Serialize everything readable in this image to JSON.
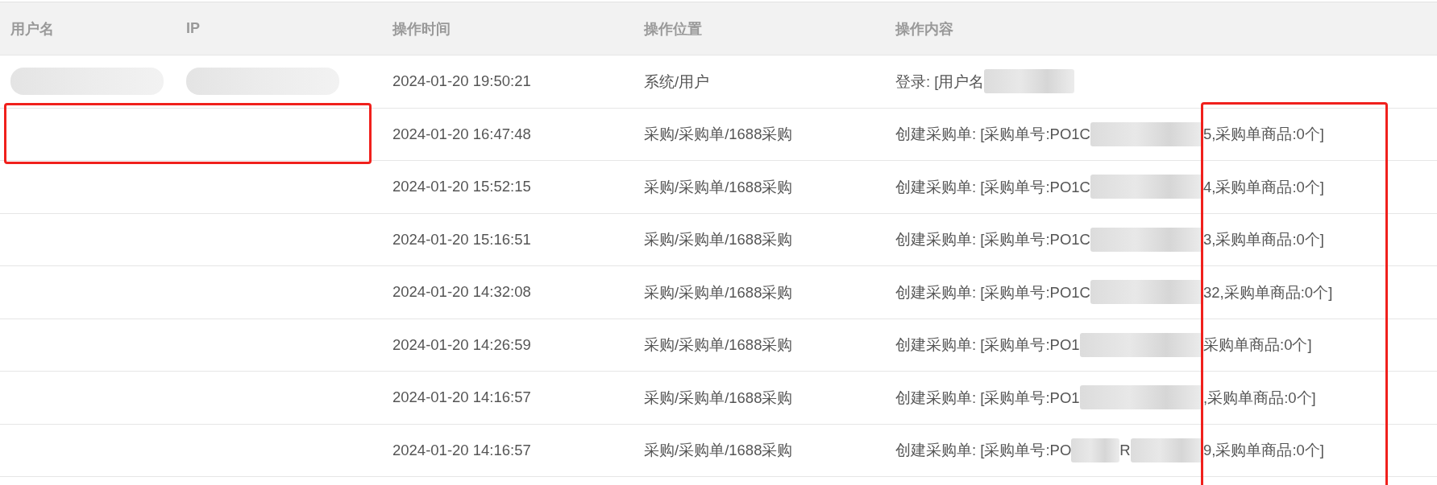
{
  "table": {
    "columns": [
      "用户名",
      "IP",
      "操作时间",
      "操作位置",
      "操作内容"
    ],
    "rows": [
      {
        "user_redacted": true,
        "ip_redacted": true,
        "time": "2024-01-20 19:50:21",
        "location": "系统/用户",
        "content": [
          {
            "kind": "text",
            "text": "登录: [用户名"
          },
          {
            "kind": "redaction"
          }
        ]
      },
      {
        "time": "2024-01-20 16:47:48",
        "location": "采购/采购单/1688采购",
        "content": [
          {
            "kind": "text",
            "text": "创建采购单: [采购单号:PO1C"
          },
          {
            "kind": "redaction"
          },
          {
            "kind": "text",
            "text": "5,采购单商品:0个]"
          }
        ]
      },
      {
        "time": "2024-01-20 15:52:15",
        "location": "采购/采购单/1688采购",
        "content": [
          {
            "kind": "text",
            "text": "创建采购单: [采购单号:PO1C"
          },
          {
            "kind": "redaction"
          },
          {
            "kind": "text",
            "text": "4,采购单商品:0个]"
          }
        ]
      },
      {
        "time": "2024-01-20 15:16:51",
        "location": "采购/采购单/1688采购",
        "content": [
          {
            "kind": "text",
            "text": "创建采购单: [采购单号:PO1C"
          },
          {
            "kind": "redaction"
          },
          {
            "kind": "text",
            "text": "3,采购单商品:0个]"
          }
        ]
      },
      {
        "time": "2024-01-20 14:32:08",
        "location": "采购/采购单/1688采购",
        "content": [
          {
            "kind": "text",
            "text": "创建采购单: [采购单号:PO1C"
          },
          {
            "kind": "redaction"
          },
          {
            "kind": "text",
            "text": "32,采购单商品:0个]"
          }
        ]
      },
      {
        "time": "2024-01-20 14:26:59",
        "location": "采购/采购单/1688采购",
        "content": [
          {
            "kind": "text",
            "text": "创建采购单: [采购单号:PO1"
          },
          {
            "kind": "redaction"
          },
          {
            "kind": "text",
            "text": "采购单商品:0个]"
          }
        ]
      },
      {
        "time": "2024-01-20 14:16:57",
        "location": "采购/采购单/1688采购",
        "content": [
          {
            "kind": "text",
            "text": "创建采购单: [采购单号:PO1"
          },
          {
            "kind": "redaction"
          },
          {
            "kind": "text",
            "text": ",采购单商品:0个]"
          }
        ]
      },
      {
        "time": "2024-01-20 14:16:57",
        "location": "采购/采购单/1688采购",
        "content": [
          {
            "kind": "text",
            "text": "创建采购单: [采购单号:PO"
          },
          {
            "kind": "redaction"
          },
          {
            "kind": "text",
            "text": "R"
          },
          {
            "kind": "redaction"
          },
          {
            "kind": "text",
            "text": "9,采购单商品:0个]"
          }
        ]
      }
    ]
  },
  "annotations": [
    {
      "kind": "box"
    },
    {
      "kind": "box"
    }
  ]
}
